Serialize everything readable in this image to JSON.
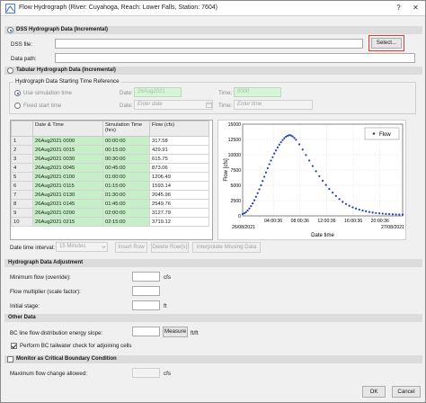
{
  "window": {
    "title": "Flow Hydrograph (River: Cuyahoga, Reach: Lower Falls, Station: 7604)",
    "help": "?",
    "close": "✕"
  },
  "dss": {
    "section_label": "DSS Hydrograph Data (Incremental)",
    "selected": true,
    "file_label": "DSS file:",
    "file_value": "",
    "select_button": "Select...",
    "path_label": "Data path:",
    "path_value": ""
  },
  "tabular": {
    "section_label": "Tabular Hydrograph Data (Incremental)",
    "selected": false,
    "ref_group_label": "Hydrograph Data Starting Time Reference",
    "use_sim_label": "Use simulation time",
    "use_sim_selected": true,
    "fixed_label": "Fixed start time",
    "fixed_selected": false,
    "date_label": "Date:",
    "sim_date_value": "26Aug2021",
    "time_label": "Time:",
    "sim_time_value": "0000",
    "fixed_date_placeholder": "Enter date",
    "fixed_time_placeholder": "Enter time"
  },
  "grid": {
    "headers": [
      "Date & Time",
      "Simulation Time (hrs)",
      "Flow (cfs)"
    ],
    "rows": [
      {
        "n": "1",
        "date": "26Aug2021 0000",
        "sim": "00:00:00",
        "flow": "317.58"
      },
      {
        "n": "2",
        "date": "26Aug2021 0015",
        "sim": "00:15:00",
        "flow": "429.91"
      },
      {
        "n": "3",
        "date": "26Aug2021 0030",
        "sim": "00:30:00",
        "flow": "615.75"
      },
      {
        "n": "4",
        "date": "26Aug2021 0045",
        "sim": "00:45:00",
        "flow": "873.06"
      },
      {
        "n": "5",
        "date": "26Aug2021 0100",
        "sim": "01:00:00",
        "flow": "1206.49"
      },
      {
        "n": "6",
        "date": "26Aug2021 0115",
        "sim": "01:15:00",
        "flow": "1593.14"
      },
      {
        "n": "7",
        "date": "26Aug2021 0130",
        "sim": "01:30:00",
        "flow": "2045.96"
      },
      {
        "n": "8",
        "date": "26Aug2021 0145",
        "sim": "01:45:00",
        "flow": "2549.76"
      },
      {
        "n": "9",
        "date": "26Aug2021 0200",
        "sim": "02:00:00",
        "flow": "3127.79"
      },
      {
        "n": "10",
        "date": "26Aug2021 0215",
        "sim": "02:15:00",
        "flow": "3719.12"
      }
    ]
  },
  "grid_controls": {
    "interval_label": "Date time interval:",
    "interval_value": "15 Minutes",
    "insert_row": "Insert Row",
    "delete_rows": "Delete Row(s)",
    "interpolate": "Interpolate Missing Data"
  },
  "adjustment": {
    "section_label": "Hydrograph Data Adjustment",
    "min_flow_label": "Minimum flow (override):",
    "min_flow_unit": "cfs",
    "multiplier_label": "Flow multiplier (scale factor):",
    "initial_stage_label": "Initial stage:",
    "initial_stage_unit": "ft"
  },
  "other": {
    "section_label": "Other Data",
    "bc_slope_label": "BC line flow distribution energy slope:",
    "measure_button": "Measure",
    "bc_slope_unit": "ft/ft",
    "tailwater_label": "Perform BC tailwater check for adjoining cells",
    "tailwater_checked": true
  },
  "monitor": {
    "section_label": "Monitor as Critical Boundary Condition",
    "checked": false,
    "max_change_label": "Maximum flow change allowed:",
    "max_change_unit": "cfs"
  },
  "footer": {
    "ok": "OK",
    "cancel": "Cancel"
  },
  "colors": {
    "series": "#1f3fbf",
    "grid_green": "#c7efc7",
    "highlight_border": "#e53935"
  },
  "chart_data": {
    "type": "scatter",
    "ylabel": "Flow [cfs]",
    "xlabel": "Date time",
    "legend": [
      "Flow"
    ],
    "legend_position": "top-right",
    "grid": true,
    "ylim": [
      0,
      15000
    ],
    "yticks": [
      "0",
      "2500",
      "5000",
      "7500",
      "10000",
      "12500",
      "15000"
    ],
    "xlim_hours": [
      0,
      24
    ],
    "x_tick_hours": [
      4.6,
      8.6,
      12.6,
      16.6,
      20.6,
      24
    ],
    "xticks_top": [
      "04:00:36",
      "08:00:36",
      "12:00:36",
      "16:00:36",
      "20:00:36",
      ""
    ],
    "xticks_bottom": [
      "26/08/2021",
      "",
      "",
      "",
      "",
      "27/08/2021"
    ],
    "series": [
      {
        "name": "Flow",
        "x_hours": [
          0,
          0.25,
          0.5,
          0.75,
          1,
          1.25,
          1.5,
          1.75,
          2,
          2.25,
          2.5,
          2.75,
          3,
          3.25,
          3.5,
          3.75,
          4,
          4.25,
          4.5,
          4.75,
          5,
          5.25,
          5.5,
          5.75,
          6,
          6.25,
          6.5,
          6.75,
          7,
          7.25,
          7.5,
          7.75,
          8,
          8.5,
          9,
          9.5,
          10,
          10.5,
          11,
          11.5,
          12,
          12.5,
          13,
          13.5,
          14,
          14.5,
          15,
          15.5,
          16,
          16.5,
          17,
          17.5,
          18,
          18.5,
          19,
          19.5,
          20,
          20.5,
          21,
          21.5,
          22,
          22.5,
          23,
          23.5,
          24
        ],
        "y": [
          317.58,
          429.91,
          615.75,
          873.06,
          1206.49,
          1593.14,
          2045.96,
          2549.76,
          3127.79,
          3719.12,
          4350,
          5000,
          5700,
          6400,
          7100,
          7800,
          8450,
          9050,
          9600,
          10200,
          10700,
          11200,
          11650,
          12050,
          12400,
          12700,
          12950,
          13100,
          13200,
          13150,
          13000,
          12750,
          12450,
          11700,
          10850,
          9950,
          9050,
          8150,
          7300,
          6500,
          5750,
          5050,
          4400,
          3800,
          3250,
          2750,
          2300,
          1950,
          1650,
          1400,
          1200,
          1030,
          880,
          750,
          640,
          550,
          470,
          410,
          360,
          320,
          290,
          260,
          240,
          220,
          205
        ]
      }
    ]
  }
}
